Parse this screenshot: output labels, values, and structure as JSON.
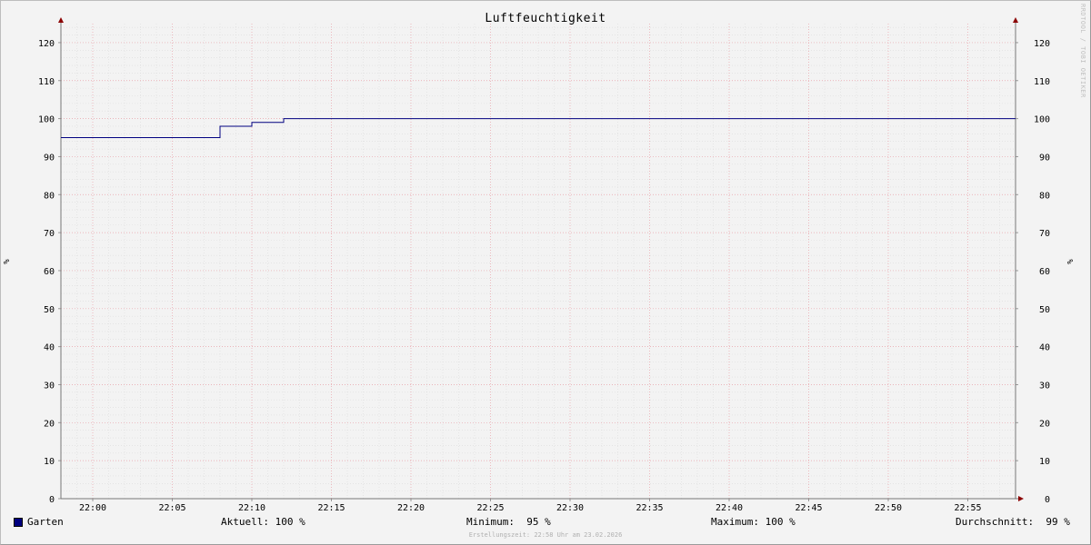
{
  "chart_data": {
    "type": "line",
    "title": "Luftfeuchtigkeit",
    "ylabel": "%",
    "ylabel_right": "%",
    "ylim": [
      0,
      125
    ],
    "y_ticks": [
      0,
      10,
      20,
      30,
      40,
      50,
      60,
      70,
      80,
      90,
      100,
      110,
      120
    ],
    "x_ticks": [
      "22:00",
      "22:05",
      "22:10",
      "22:15",
      "22:20",
      "22:25",
      "22:30",
      "22:35",
      "22:40",
      "22:45",
      "22:50",
      "22:55"
    ],
    "xlim": [
      "21:58",
      "22:58"
    ],
    "grid": true,
    "series": [
      {
        "name": "Garten",
        "color": "#000080",
        "points": [
          {
            "x": "21:58",
            "y": 95
          },
          {
            "x": "22:08",
            "y": 95
          },
          {
            "x": "22:08",
            "y": 98
          },
          {
            "x": "22:10",
            "y": 98
          },
          {
            "x": "22:10",
            "y": 99
          },
          {
            "x": "22:12",
            "y": 99
          },
          {
            "x": "22:12",
            "y": 100
          },
          {
            "x": "22:58",
            "y": 100
          }
        ]
      }
    ]
  },
  "legend": {
    "series_name": "Garten",
    "swatch_color": "#000080",
    "current": "Aktuell: 100 %",
    "minimum": "Minimum:  95 %",
    "maximum": "Maximum: 100 %",
    "average": "Durchschnitt:  99 %"
  },
  "footer": "Erstellungszeit: 22:58 Uhr am 23.02.2026",
  "watermark": "RRDTOOL / TOBI OETIKER"
}
